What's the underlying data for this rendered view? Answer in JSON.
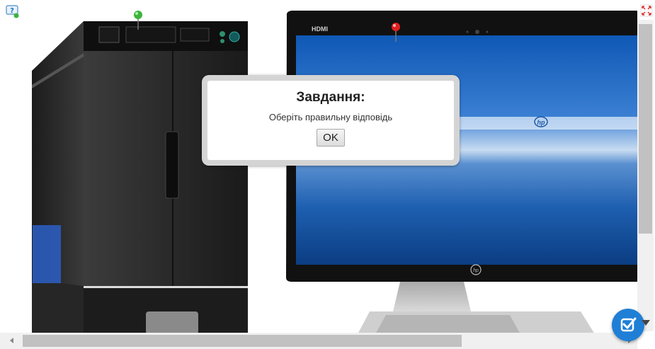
{
  "dialog": {
    "title": "Завдання:",
    "message": "Оберіть правильну відповідь",
    "ok_label": "OK"
  },
  "monitor": {
    "hdmi_label": "HDMI",
    "brand_logo": "hp"
  },
  "colors": {
    "check_button": "#1f7fd6",
    "pin_green": "#3cb43c",
    "pin_red": "#e02020"
  },
  "icons": {
    "help": "help-question-icon",
    "fullscreen": "fullscreen-icon",
    "check": "check-icon"
  }
}
